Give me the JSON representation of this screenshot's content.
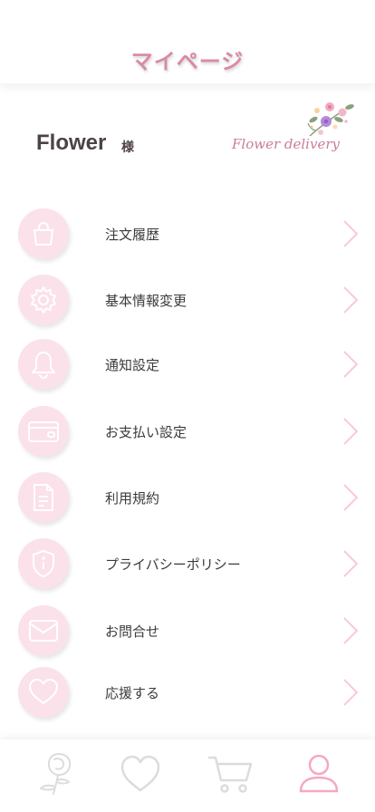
{
  "header": {
    "title": "マイページ"
  },
  "profile": {
    "username": "Flower",
    "honorific": "様",
    "brand": "Flower delivery"
  },
  "menu": {
    "items": [
      {
        "label": "注文履歴",
        "icon": "shopping-bag-icon"
      },
      {
        "label": "基本情報変更",
        "icon": "gear-icon"
      },
      {
        "label": "通知設定",
        "icon": "bell-icon"
      },
      {
        "label": "お支払い設定",
        "icon": "credit-card-icon"
      },
      {
        "label": "利用規約",
        "icon": "document-icon"
      },
      {
        "label": "プライバシーポリシー",
        "icon": "shield-info-icon"
      },
      {
        "label": "お問合せ",
        "icon": "envelope-icon"
      },
      {
        "label": "応援する",
        "icon": "heart-icon"
      }
    ]
  },
  "tabbar": {
    "tabs": [
      {
        "icon": "rose-icon",
        "active": false
      },
      {
        "icon": "heart-icon",
        "active": false
      },
      {
        "icon": "cart-icon",
        "active": false
      },
      {
        "icon": "user-icon",
        "active": true
      }
    ]
  },
  "colors": {
    "accent": "#d98aa8",
    "icon_bg": "#fbe1ea",
    "tab_inactive": "#dcdcdc",
    "tab_active": "#f4a9c0"
  }
}
